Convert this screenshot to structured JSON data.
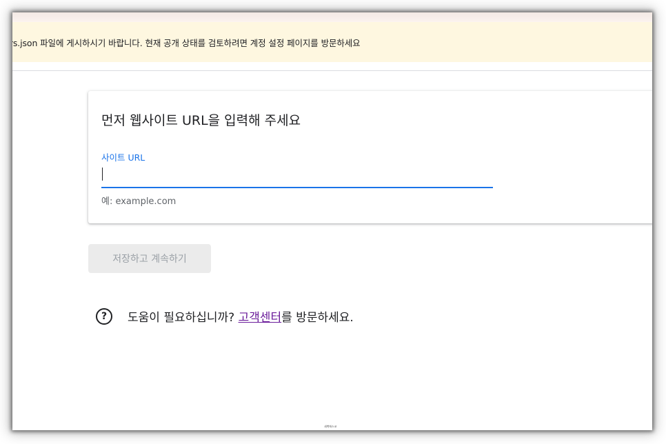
{
  "banner": {
    "message": "e sellers.json 파일에 게시하시기 바랍니다. 현재 공개 상태를 검토하려면 계정 설정 페이지를 방문하세요",
    "background": "#fef7e0"
  },
  "card": {
    "title": "먼저 웹사이트 URL을 입력해 주세요",
    "field": {
      "label": "사이트 URL",
      "value": "",
      "hint": "예: example.com"
    }
  },
  "actions": {
    "save_label": "저장하고 계속하기"
  },
  "help": {
    "icon": "help-circle-icon",
    "icon_glyph": "?",
    "prefix": "도움이 필요하십니까? ",
    "link_label": "고객센터",
    "suffix": "를 방문하세요."
  },
  "footer": {
    "mark": "새벽에스코"
  },
  "colors": {
    "accent": "#1a73e8",
    "link": "#6a1b9a",
    "disabled_button": "#ebebeb"
  }
}
